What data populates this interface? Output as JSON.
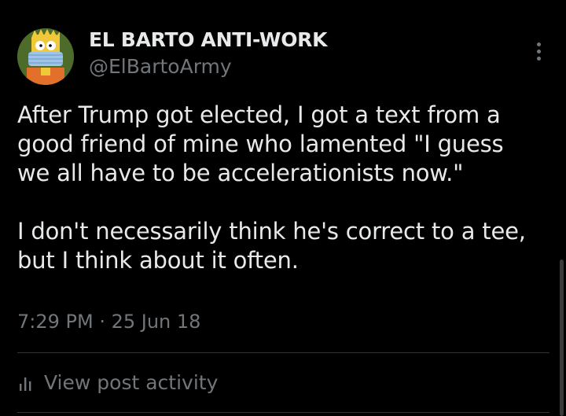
{
  "author": {
    "name": "EL BARTO ANTI-WORK",
    "handle": "@ElBartoArmy",
    "avatar_icon": "bart-simpson-masked-avatar"
  },
  "post": {
    "paragraph_1_lines": [
      "After Trump got elected, I got a text from a",
      "good friend of mine who lamented \"I guess",
      "we all have to be accelerationists now.\""
    ],
    "paragraph_2_lines": [
      "I don't necessarily think he's correct to a tee,",
      "but I think about it often."
    ],
    "timestamp": "7:29 PM · 25 Jun 18"
  },
  "actions": {
    "more_icon": "more-options-icon",
    "activity_label": "View post activity",
    "activity_icon": "analytics-bars-icon"
  },
  "colors": {
    "background": "#000000",
    "text_primary": "#e7e9ea",
    "text_secondary": "#71767b",
    "divider": "#2f3336"
  }
}
